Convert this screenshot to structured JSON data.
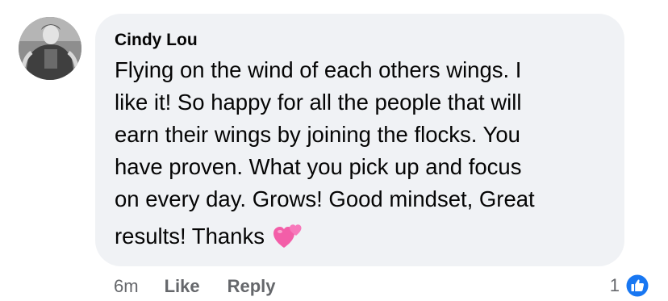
{
  "comment": {
    "author": "Cindy Lou",
    "text_lines": [
      "Flying on the wind of each others wings. I",
      "like it! So happy for all the people that will",
      "earn their wings by joining the flocks. You",
      "have proven. What you pick up and focus",
      "on every day. Grows! Good mindset, Great"
    ],
    "text_last": "results! Thanks",
    "emoji": "two-hearts-emoji"
  },
  "actions": {
    "time": "6m",
    "like": "Like",
    "reply": "Reply"
  },
  "reactions": {
    "count": "1",
    "icon": "like-icon"
  },
  "colors": {
    "bubble": "#f0f2f5",
    "meta_text": "#65676b",
    "like_blue": "#1877f2",
    "heart_pink": "#f35ea8"
  }
}
